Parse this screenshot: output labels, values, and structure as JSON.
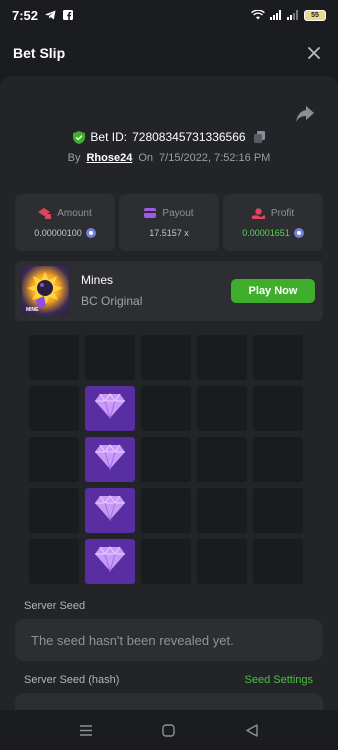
{
  "status_bar": {
    "time": "7:52",
    "battery": "55"
  },
  "header": {
    "title": "Bet Slip",
    "close_icon": "close-icon"
  },
  "bet": {
    "id_label": "Bet ID:",
    "id_value": "72808345731336566",
    "by_label": "By",
    "user": "Rhose24",
    "on_label": "On",
    "date": "7/15/2022, 7:52:16 PM"
  },
  "stats": {
    "amount": {
      "label": "Amount",
      "value": "0.00000100"
    },
    "payout": {
      "label": "Payout",
      "value": "17.5157 x"
    },
    "profit": {
      "label": "Profit",
      "value": "0.00001651"
    }
  },
  "game": {
    "name": "Mines",
    "subtitle": "BC Original",
    "play_label": "Play Now",
    "thumb_text": "MINE"
  },
  "board": {
    "rows": 5,
    "cols": 5,
    "gem_cells": [
      [
        1,
        1
      ],
      [
        2,
        1
      ],
      [
        3,
        1
      ],
      [
        4,
        1
      ]
    ]
  },
  "server_seed": {
    "label": "Server Seed",
    "value": "The seed hasn't been revealed yet."
  },
  "server_seed_hash": {
    "label": "Server Seed (hash)",
    "settings_label": "Seed Settings"
  },
  "colors": {
    "accent_green": "#3fae2b",
    "gem_purple": "#5a2ea3",
    "profit_green": "#5fd25a"
  }
}
